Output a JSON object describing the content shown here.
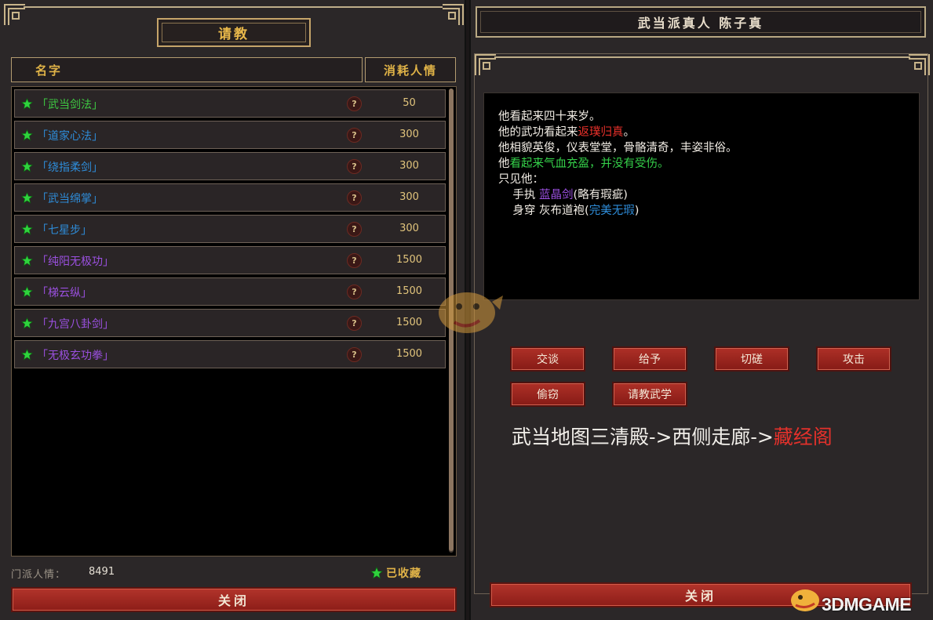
{
  "left": {
    "title": "请教",
    "headers": {
      "name": "名字",
      "cost": "消耗人情"
    },
    "skills": [
      {
        "name": "「武当剑法」",
        "cost": "50",
        "color": "#3ec942"
      },
      {
        "name": "「道家心法」",
        "cost": "300",
        "color": "#2e8cd8"
      },
      {
        "name": "「绕指柔剑」",
        "cost": "300",
        "color": "#2e8cd8"
      },
      {
        "name": "「武当绵掌」",
        "cost": "300",
        "color": "#2e8cd8"
      },
      {
        "name": "「七星步」",
        "cost": "300",
        "color": "#2e8cd8"
      },
      {
        "name": "「纯阳无极功」",
        "cost": "1500",
        "color": "#9b50e0"
      },
      {
        "name": "「梯云纵」",
        "cost": "1500",
        "color": "#9b50e0"
      },
      {
        "name": "「九宫八卦剑」",
        "cost": "1500",
        "color": "#9b50e0"
      },
      {
        "name": "「无极玄功拳」",
        "cost": "1500",
        "color": "#9b50e0"
      }
    ],
    "help_icon": "?",
    "points_label": "门派人情：",
    "points_value": "8491",
    "collected_label": "已收藏",
    "close_label": "关闭"
  },
  "right": {
    "npc_title": "武当派真人 陈子真",
    "desc": {
      "l1": "他看起来四十来岁。",
      "l2_a": "他的武功看起来",
      "l2_b": "返璞归真",
      "l2_c": "。",
      "l3": "他相貌英俊，仪表堂堂，骨骼清奇，丰姿非俗。",
      "l4_a": "他",
      "l4_b": "看起来气血充盈，并没有受伤。",
      "l5": "只见他：",
      "l6_a": "    手执 ",
      "l6_b": "蓝晶剑",
      "l6_c": "(略有瑕疵)",
      "l7_a": "    身穿 灰布道袍(",
      "l7_b": "完美无瑕",
      "l7_c": ")"
    },
    "actions": {
      "talk": "交谈",
      "give": "给予",
      "spar": "切磋",
      "attack": "攻击",
      "steal": "偷窃",
      "learn": "请教武学"
    },
    "route_prefix": "武当地图三清殿->西侧走廊->",
    "route_dest": "藏经阁",
    "close_label": "关闭"
  },
  "watermark": "3DMGAME",
  "colors": {
    "accent_gold": "#e0b347",
    "button_red": "#a52a22",
    "highlight_red": "#e8302a",
    "green": "#35d14a"
  }
}
